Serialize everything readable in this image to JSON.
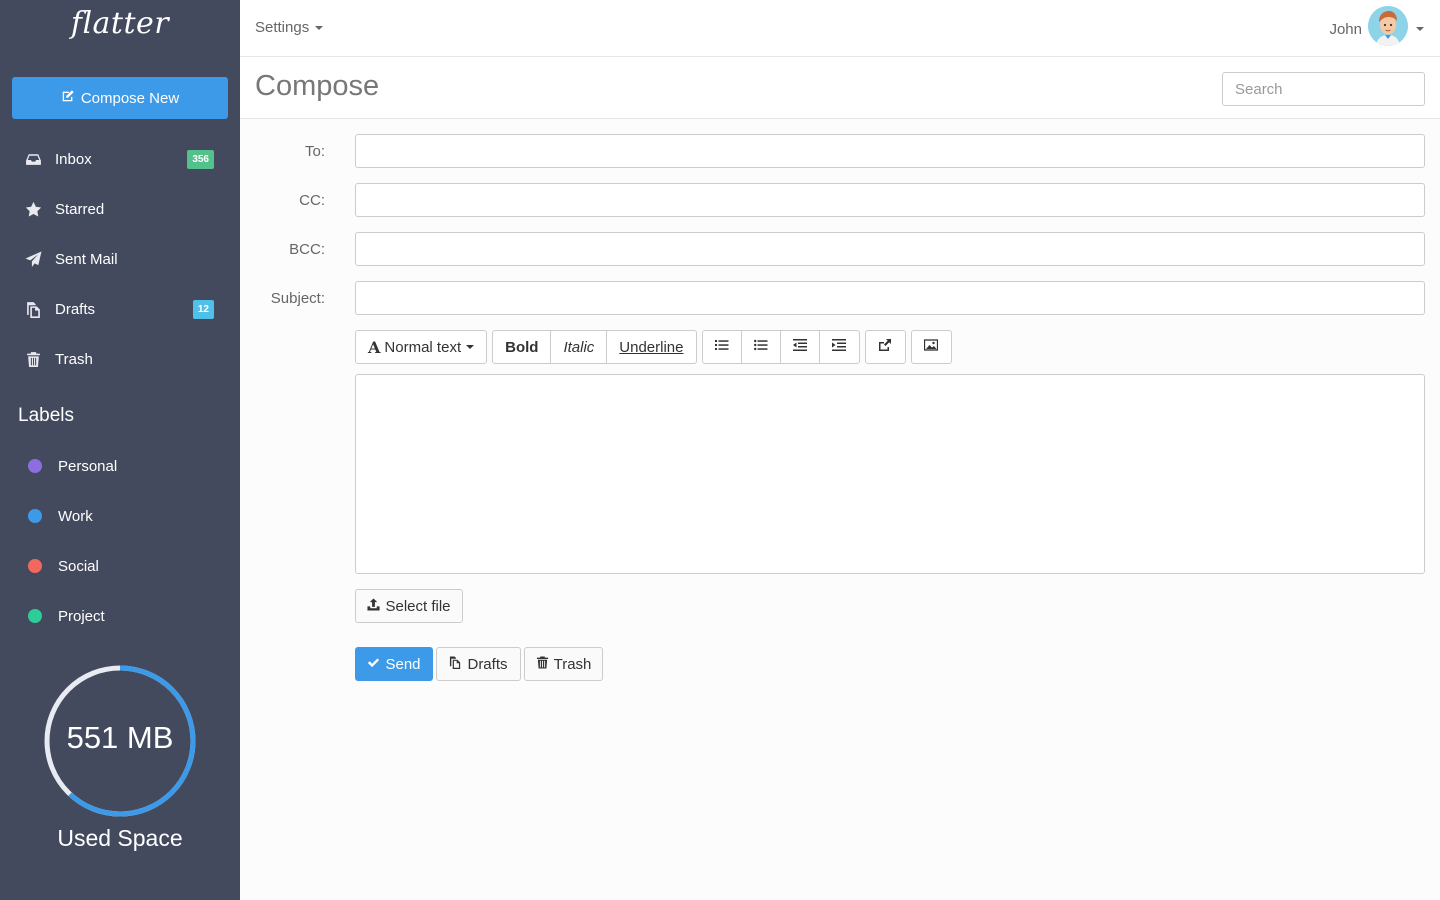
{
  "sidebar": {
    "logo": "flatter",
    "compose_label": "Compose New",
    "nav": [
      {
        "label": "Inbox",
        "icon": "inbox-icon",
        "badge": "356",
        "badge_color": "#53c18b"
      },
      {
        "label": "Starred",
        "icon": "star-icon"
      },
      {
        "label": "Sent Mail",
        "icon": "paper-plane-icon"
      },
      {
        "label": "Drafts",
        "icon": "copy-icon",
        "badge": "12",
        "badge_color": "#4fc0e8"
      },
      {
        "label": "Trash",
        "icon": "trash-icon"
      }
    ],
    "labels_title": "Labels",
    "labels": [
      {
        "label": "Personal",
        "color": "#8c6ee0"
      },
      {
        "label": "Work",
        "color": "#3d9ae8"
      },
      {
        "label": "Social",
        "color": "#f2685f"
      },
      {
        "label": "Project",
        "color": "#2ecc97"
      }
    ],
    "usage": {
      "value": "551 MB",
      "label": "Used Space",
      "fraction": 0.62
    }
  },
  "topbar": {
    "settings_label": "Settings",
    "user_name": "John"
  },
  "header": {
    "title": "Compose",
    "search_placeholder": "Search"
  },
  "form": {
    "to_label": "To:",
    "cc_label": "CC:",
    "bcc_label": "BCC:",
    "subject_label": "Subject:"
  },
  "toolbar": {
    "font_label": "Normal text",
    "bold_label": "Bold",
    "italic_label": "Italic",
    "underline_label": "Underline"
  },
  "actions": {
    "select_file_label": "Select file",
    "send_label": "Send",
    "drafts_label": "Drafts",
    "trash_label": "Trash"
  },
  "colors": {
    "sidebar_bg": "#434a5e",
    "accent": "#3d9ae8"
  }
}
